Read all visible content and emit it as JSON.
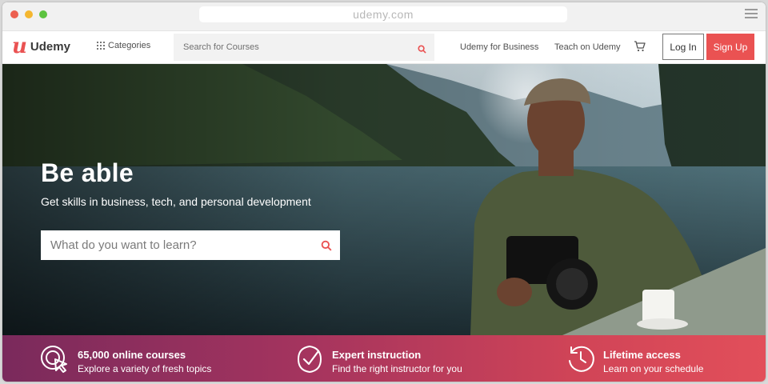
{
  "browser": {
    "url": "udemy.com"
  },
  "nav": {
    "logo_text": "Udemy",
    "categories_label": "Categories",
    "search_placeholder": "Search for Courses",
    "business_link": "Udemy for Business",
    "teach_link": "Teach on Udemy",
    "login_label": "Log In",
    "signup_label": "Sign Up",
    "icons": [
      "grid-icon",
      "search-icon",
      "cart-icon",
      "menu-icon"
    ]
  },
  "hero": {
    "title": "Be able",
    "subtitle": "Get skills in business, tech, and personal development",
    "search_placeholder": "What do you want to learn?"
  },
  "features": [
    {
      "title": "65,000 online courses",
      "description": "Explore a variety of fresh topics",
      "icon": "target-cursor-icon"
    },
    {
      "title": "Expert instruction",
      "description": "Find the right instructor for you",
      "icon": "badge-check-icon"
    },
    {
      "title": "Lifetime access",
      "description": "Learn on your schedule",
      "icon": "history-clock-icon"
    }
  ],
  "colors": {
    "brand": "#ea5252",
    "feature_bar_start": "#7a2a5c",
    "feature_bar_end": "#e24f5a"
  }
}
